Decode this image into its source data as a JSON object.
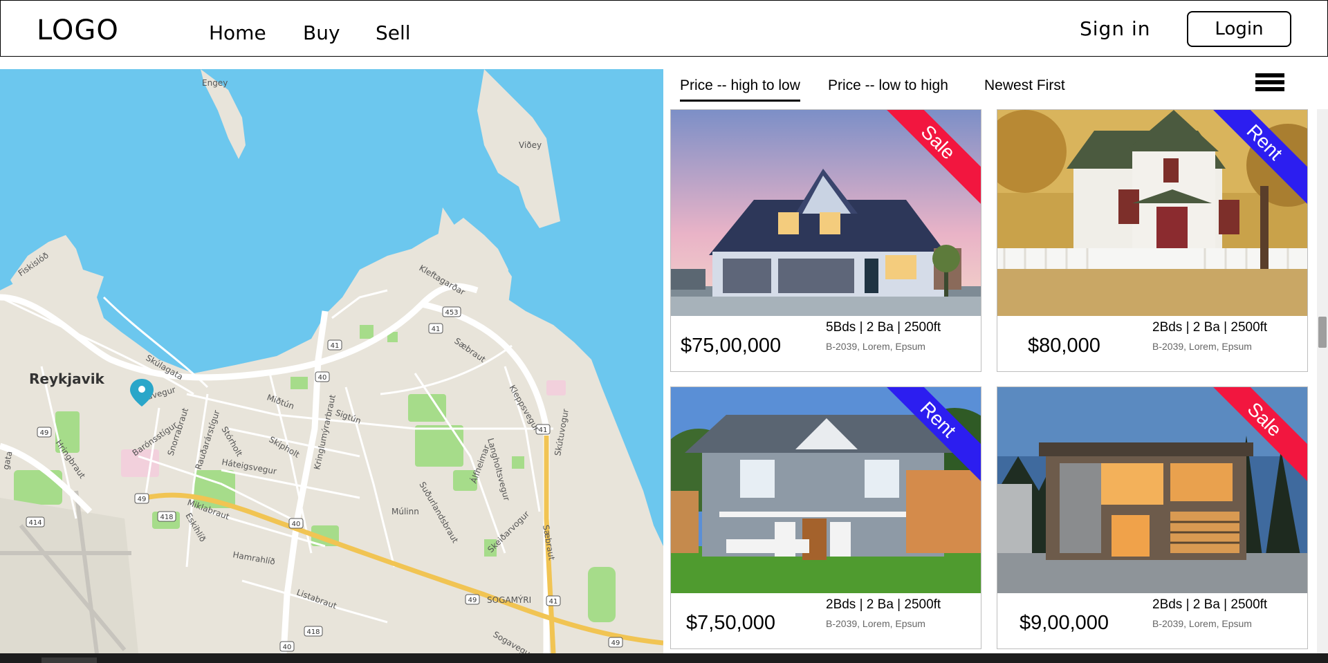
{
  "header": {
    "logo": "LOGO",
    "nav": [
      "Home",
      "Buy",
      "Sell"
    ],
    "sign_in": "Sign in",
    "login": "Login"
  },
  "map": {
    "labels": {
      "city": "Reykjavik",
      "engey": "Engey",
      "videy": "Viðey",
      "fiskislod": "Fiskislóð",
      "kletta": "Kleftagarðar",
      "saebraut": "Sæbraut",
      "skulagata": "Skúlagata",
      "laugavegur": "avegur",
      "baronsstigur": "Barónsstígur",
      "snorrabraut": "Snorrabraut",
      "raudarar": "Rauðarárstígur",
      "stakholt": "Stórholt",
      "skipholt": "Skipholt",
      "kringlu": "Kringlumýrarbraut",
      "sigtun": "Sigtún",
      "midtun": "Miðtún",
      "hateigsvegur": "Háteigsvegur",
      "kleppsvegur": "Kleppsvegur",
      "langholts": "Langholtsvegur",
      "alfheimar": "Álfheimar",
      "mulinn": "Múlinn",
      "sudurlands": "Suðurlandsbraut",
      "skeidarvogur": "Skeiðarvogur",
      "saebraut2": "Sæbraut",
      "miklabraut": "Miklabraut",
      "eskihlid": "Eskihlíð",
      "hamrahlid": "Hamrahlíð",
      "listabraut": "Listabraut",
      "sogamyri": "SOGAMÝRI",
      "hringbraut": "Hringbraut",
      "skutuvogur": "Skútuvogur",
      "sogavegur": "Sogavegur",
      "gata": "gata"
    },
    "road_numbers": [
      "453",
      "41",
      "41",
      "40",
      "49",
      "41",
      "49",
      "418",
      "414",
      "40",
      "418",
      "40",
      "49",
      "41",
      "49",
      "49"
    ],
    "colors": {
      "water": "#6cc7ee",
      "land": "#e8e4da",
      "park": "#a6dc8a",
      "highway": "#f1c453",
      "road": "#ffffff",
      "pin": "#2aa6c9"
    }
  },
  "sort": {
    "options": [
      "Price -- high to low",
      "Price -- low to high",
      "Newest First"
    ],
    "active_index": 0
  },
  "listings": [
    {
      "price": "$75,00,000",
      "specs": "5Bds | 2 Ba | 2500ft",
      "address": "B-2039, Lorem, Epsum",
      "tag": "Sale",
      "tag_color": "#f2163f"
    },
    {
      "price": "$80,000",
      "specs": "2Bds | 2 Ba | 2500ft",
      "address": "B-2039, Lorem, Epsum",
      "tag": "Rent",
      "tag_color": "#2c1ef0"
    },
    {
      "price": "$7,50,000",
      "specs": "2Bds | 2 Ba | 2500ft",
      "address": "B-2039, Lorem, Epsum",
      "tag": "Rent",
      "tag_color": "#2c1ef0"
    },
    {
      "price": "$9,00,000",
      "specs": "2Bds | 2 Ba | 2500ft",
      "address": "B-2039, Lorem, Epsum",
      "tag": "Sale",
      "tag_color": "#f2163f"
    }
  ]
}
